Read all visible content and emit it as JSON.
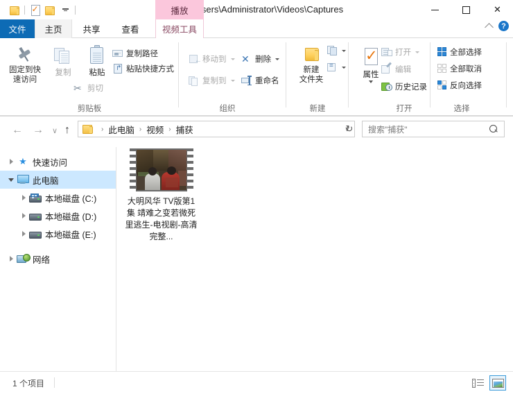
{
  "window": {
    "title": "C:\\Users\\Administrator\\Videos\\Captures",
    "minimize_label": "—",
    "maximize_label": "□",
    "close_label": "✕"
  },
  "quick_access_toolbar": {
    "items": [
      {
        "name": "properties-qat",
        "icon": "properties-icon"
      },
      {
        "name": "new-folder-qat",
        "icon": "folder-icon"
      }
    ],
    "customize_label": "▾"
  },
  "contextual_tab": {
    "header": "播放",
    "group": "视频工具"
  },
  "tabs": [
    {
      "id": "file",
      "label": "文件",
      "active": false,
      "primary": true
    },
    {
      "id": "home",
      "label": "主页",
      "active": true
    },
    {
      "id": "share",
      "label": "共享",
      "active": false
    },
    {
      "id": "view",
      "label": "查看",
      "active": false
    },
    {
      "id": "video-tools",
      "label": "视频工具",
      "active": false
    }
  ],
  "ribbon_controls": {
    "collapse_label": "∧",
    "help_label": "?"
  },
  "ribbon": {
    "groups": [
      {
        "id": "clipboard",
        "label": "剪贴板",
        "big_buttons": [
          {
            "id": "pin-to-quick-access",
            "label_line1": "固定到快",
            "label_line2": "速访问",
            "icon": "pin-icon",
            "disabled": false
          },
          {
            "id": "copy",
            "label_line1": "复制",
            "label_line2": "",
            "icon": "copy-icon",
            "disabled": true
          },
          {
            "id": "paste",
            "label_line1": "粘贴",
            "label_line2": "",
            "icon": "clipboard-icon",
            "disabled": false
          }
        ],
        "small_buttons": [
          {
            "id": "copy-path",
            "label": "复制路径",
            "icon": "copy-path-icon",
            "disabled": false
          },
          {
            "id": "paste-shortcut",
            "label": "粘贴快捷方式",
            "icon": "paste-shortcut-icon",
            "disabled": false
          },
          {
            "id": "cut",
            "label": "剪切",
            "icon": "scissors-icon",
            "disabled": true
          }
        ]
      },
      {
        "id": "organize",
        "label": "组织",
        "small_buttons": [
          {
            "id": "move-to",
            "label": "移动到",
            "icon": "move-to-icon",
            "disabled": true,
            "caret": true
          },
          {
            "id": "copy-to",
            "label": "复制到",
            "icon": "copy-to-icon",
            "disabled": true,
            "caret": true
          },
          {
            "id": "delete",
            "label": "删除",
            "icon": "delete-x-icon",
            "disabled": false,
            "caret": true
          },
          {
            "id": "rename",
            "label": "重命名",
            "icon": "rename-icon",
            "disabled": false,
            "caret": false
          }
        ]
      },
      {
        "id": "new",
        "label": "新建",
        "big_buttons": [
          {
            "id": "new-folder",
            "label_line1": "新建",
            "label_line2": "文件夹",
            "icon": "new-folder-icon",
            "disabled": false
          }
        ],
        "small_buttons": [
          {
            "id": "new-item",
            "label": "",
            "icon": "new-item-icon",
            "disabled": false,
            "caret": true
          },
          {
            "id": "easy-access",
            "label": "",
            "icon": "easy-access-icon",
            "disabled": false,
            "caret": true
          }
        ]
      },
      {
        "id": "open",
        "label": "打开",
        "big_buttons": [
          {
            "id": "properties",
            "label_line1": "属性",
            "label_line2": "",
            "icon": "properties-icon",
            "disabled": false
          }
        ],
        "small_buttons": [
          {
            "id": "open",
            "label": "打开",
            "icon": "open-icon",
            "disabled": true,
            "caret": true
          },
          {
            "id": "edit",
            "label": "编辑",
            "icon": "edit-icon",
            "disabled": true,
            "caret": false
          },
          {
            "id": "history",
            "label": "历史记录",
            "icon": "history-icon",
            "disabled": false,
            "caret": false
          }
        ]
      },
      {
        "id": "select",
        "label": "选择",
        "small_buttons": [
          {
            "id": "select-all",
            "label": "全部选择",
            "icon": "select-all-icon",
            "disabled": false
          },
          {
            "id": "select-none",
            "label": "全部取消",
            "icon": "select-none-icon",
            "disabled": false
          },
          {
            "id": "invert-selection",
            "label": "反向选择",
            "icon": "invert-selection-icon",
            "disabled": false
          }
        ]
      }
    ]
  },
  "navigation": {
    "back_label": "←",
    "forward_label": "→",
    "recent_label": "∨",
    "up_label": "↑",
    "breadcrumbs": [
      "此电脑",
      "视频",
      "捕获"
    ],
    "separator": "›",
    "dropdown_label": "∨",
    "refresh_label": "↻"
  },
  "search": {
    "placeholder": "搜索\"捕获\"",
    "value": "搜索\"捕获\""
  },
  "sidebar": {
    "items": [
      {
        "id": "quick-access",
        "label": "快速访问",
        "icon": "star-icon",
        "expanded": false,
        "indent": 0,
        "selected": false
      },
      {
        "id": "this-pc",
        "label": "此电脑",
        "icon": "computer-icon",
        "expanded": true,
        "indent": 0,
        "selected": true
      },
      {
        "id": "local-disk-c",
        "label": "本地磁盘 (C:)",
        "icon": "system-drive-icon",
        "expanded": false,
        "indent": 1,
        "selected": false
      },
      {
        "id": "local-disk-d",
        "label": "本地磁盘 (D:)",
        "icon": "drive-icon",
        "expanded": false,
        "indent": 1,
        "selected": false
      },
      {
        "id": "local-disk-e",
        "label": "本地磁盘 (E:)",
        "icon": "drive-icon",
        "expanded": false,
        "indent": 1,
        "selected": false
      },
      {
        "id": "network",
        "label": "网络",
        "icon": "network-icon",
        "expanded": false,
        "indent": 0,
        "selected": false
      }
    ]
  },
  "files": [
    {
      "id": "video-1",
      "name": "大明风华 TV版第1集 靖难之变若微死里逃生-电视剧-高清完整...",
      "type": "video",
      "selected": false
    }
  ],
  "status_bar": {
    "item_count": "1 个项目",
    "views": [
      {
        "id": "details-view",
        "icon": "details-view-icon",
        "active": false
      },
      {
        "id": "large-icons-view",
        "icon": "thumbnail-view-icon",
        "active": true
      }
    ]
  }
}
